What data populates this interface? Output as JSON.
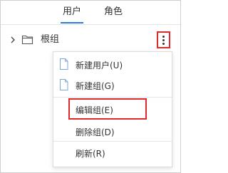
{
  "tabs": [
    {
      "label": "用户",
      "active": true
    },
    {
      "label": "角色",
      "active": false
    }
  ],
  "tree": {
    "root_label": "根组"
  },
  "context_menu": {
    "items": [
      {
        "label": "新建用户(U)",
        "icon": "document-icon"
      },
      {
        "label": "新建组(G)",
        "icon": "document-icon"
      },
      {
        "label": "编辑组(E)",
        "icon": "",
        "highlighted": true
      },
      {
        "label": "删除组(D)",
        "icon": ""
      },
      {
        "label": "刷新(R)",
        "icon": ""
      }
    ]
  },
  "colors": {
    "accent": "#2d7be5",
    "highlight": "#e02a2a",
    "icon_blue": "#7fa6d9"
  }
}
